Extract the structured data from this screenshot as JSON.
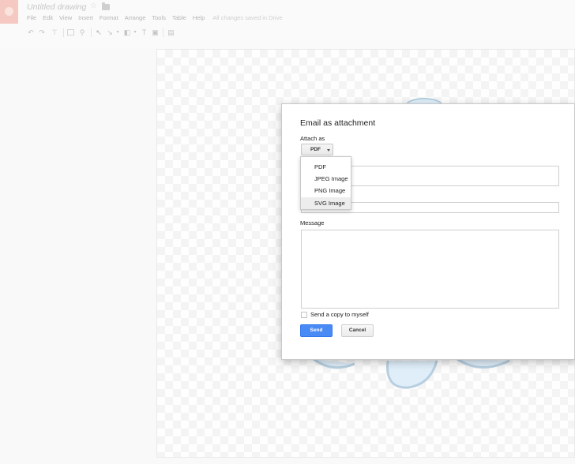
{
  "app": {
    "title": "Untitled drawing",
    "save_status": "All changes saved in Drive",
    "logo_icon": "drawings-logo-icon"
  },
  "menu": [
    "File",
    "Edit",
    "View",
    "Insert",
    "Format",
    "Arrange",
    "Tools",
    "Table",
    "Help"
  ],
  "toolbar": {
    "icons": [
      "undo-icon",
      "redo-icon",
      "paint-format-icon",
      "zoom-fit-icon",
      "zoom-icon",
      "select-icon",
      "line-icon",
      "shape-icon",
      "text-box-icon",
      "image-icon",
      "comment-icon"
    ]
  },
  "dialog": {
    "title": "Email as attachment",
    "attach_label": "Attach as",
    "attach_value": "PDF",
    "message_label": "Message",
    "copy_label": "Send a copy to myself",
    "copy_checked": false,
    "send_label": "Send",
    "cancel_label": "Cancel"
  },
  "dropdown": {
    "options": [
      "PDF",
      "JPEG Image",
      "PNG Image",
      "SVG Image"
    ],
    "highlighted": "SVG Image"
  },
  "colors": {
    "send_button": "#4a8af4",
    "logo_bg": "#f5c9c1",
    "shape_fill": "#dfeef9",
    "shape_stroke": "#b7cfe0"
  }
}
